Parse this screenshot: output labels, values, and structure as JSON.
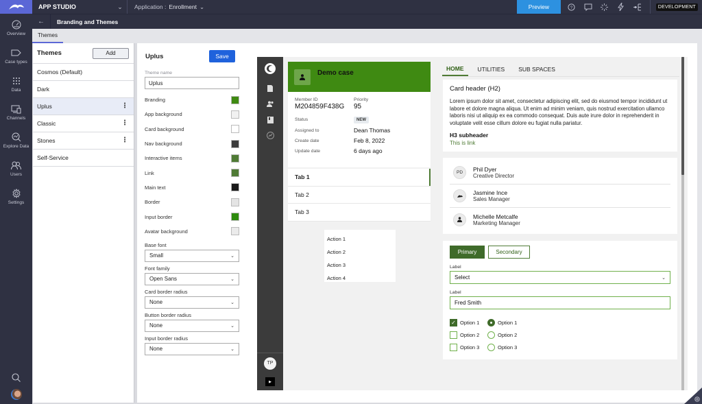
{
  "topbar": {
    "app_name": "APP STUDIO",
    "application_label": "Application :",
    "application_value": "Enrollment",
    "preview_label": "Preview",
    "icons": [
      "help-icon",
      "chat-icon",
      "sparkle-icon",
      "lightning-icon",
      "hierarchy-icon"
    ],
    "environment": "DEVELOPMENT"
  },
  "leftnav": {
    "items": [
      {
        "label": "Overview",
        "icon": "gauge-icon"
      },
      {
        "label": "Case types",
        "icon": "case-type-icon"
      },
      {
        "label": "Data",
        "icon": "grid-dots-icon"
      },
      {
        "label": "Channels",
        "icon": "devices-icon"
      },
      {
        "label": "Explore Data",
        "icon": "explore-icon"
      },
      {
        "label": "Users",
        "icon": "users-icon"
      },
      {
        "label": "Settings",
        "icon": "gear-icon"
      }
    ]
  },
  "subheader": {
    "title": "Branding and Themes"
  },
  "tabs": {
    "active": "Themes"
  },
  "themes_panel": {
    "title": "Themes",
    "add_label": "Add",
    "items": [
      {
        "label": "Cosmos (Default)",
        "menu": false,
        "active": false
      },
      {
        "label": "Dark",
        "menu": false,
        "active": false
      },
      {
        "label": "Uplus",
        "menu": true,
        "active": true
      },
      {
        "label": "Classic",
        "menu": true,
        "active": false
      },
      {
        "label": "Stones",
        "menu": true,
        "active": false
      },
      {
        "label": "Self-Service",
        "menu": false,
        "active": false
      }
    ]
  },
  "editor": {
    "title": "Uplus",
    "save_label": "Save",
    "theme_name_label": "Theme name",
    "theme_name_value": "Uplus",
    "colors": [
      {
        "label": "Branding",
        "color": "#3f8a12"
      },
      {
        "label": "App background",
        "color": "#f1f1f1"
      },
      {
        "label": "Card background",
        "color": "#ffffff"
      },
      {
        "label": "Nav background",
        "color": "#3b3b3b"
      },
      {
        "label": "Interactive items",
        "color": "#4f7b35"
      },
      {
        "label": "Link",
        "color": "#4f7b35"
      },
      {
        "label": "Main text",
        "color": "#1a1a1a"
      },
      {
        "label": "Border",
        "color": "#e4e4e4"
      },
      {
        "label": "Input border",
        "color": "#2e8b0e"
      },
      {
        "label": "Avatar background",
        "color": "#ebebeb"
      }
    ],
    "selects": [
      {
        "label": "Base font",
        "value": "Small"
      },
      {
        "label": "Font family",
        "value": "Open Sans"
      },
      {
        "label": "Card border radius",
        "value": "None"
      },
      {
        "label": "Button border radius",
        "value": "None"
      },
      {
        "label": "Input border radius",
        "value": "None"
      }
    ]
  },
  "preview": {
    "avatar_initials": "TP",
    "case": {
      "title": "Demo case",
      "member_id_label": "Member ID",
      "member_id": "M204859F438G",
      "priority_label": "Priority",
      "priority": "95",
      "status_label": "Status",
      "status": "NEW",
      "assigned_label": "Assigned to",
      "assigned": "Dean Thomas",
      "create_label": "Create date",
      "create": "Feb 8, 2022",
      "update_label": "Update date",
      "update": "6 days ago",
      "tabs": [
        "Tab 1",
        "Tab 2",
        "Tab 3"
      ]
    },
    "actions": [
      "Action 1",
      "Action 2",
      "Action 3",
      "Action 4"
    ],
    "nav_tabs": [
      "HOME",
      "UTILITIES",
      "SUB SPACES"
    ],
    "card": {
      "h2": "Card header (H2)",
      "body": "Lorem ipsum dolor sit amet, consectetur adipiscing elit, sed do eiusmod tempor incididunt ut labore et dolore magna aliqua. Ut enim ad minim veniam, quis nostrud exercitation ullamco laboris nisi ut aliquip ex ea commodo consequat. Duis aute irure dolor in reprehenderit in voluptate velit esse cillum dolore eu fugiat nulla pariatur.",
      "h3": "H3 subheader",
      "link": "This is link"
    },
    "people": [
      {
        "name": "Phil Dyer",
        "role": "Creative Director",
        "avatar": "PD"
      },
      {
        "name": "Jasmine Ince",
        "role": "Sales Manager",
        "avatar": ""
      },
      {
        "name": "Michelle Metcalfe",
        "role": "Marketing Manager",
        "avatar": ""
      }
    ],
    "form": {
      "primary_label": "Primary",
      "secondary_label": "Secondary",
      "select_label": "Label",
      "select_value": "Select",
      "input_label": "Label",
      "input_value": "Fred Smith",
      "checkboxes": [
        {
          "label": "Option 1",
          "checked": true
        },
        {
          "label": "Option 2",
          "checked": false
        },
        {
          "label": "Option 3",
          "checked": false
        }
      ],
      "radios": [
        {
          "label": "Option 1",
          "checked": true
        },
        {
          "label": "Option 2",
          "checked": false
        },
        {
          "label": "Option 3",
          "checked": false
        }
      ]
    }
  }
}
